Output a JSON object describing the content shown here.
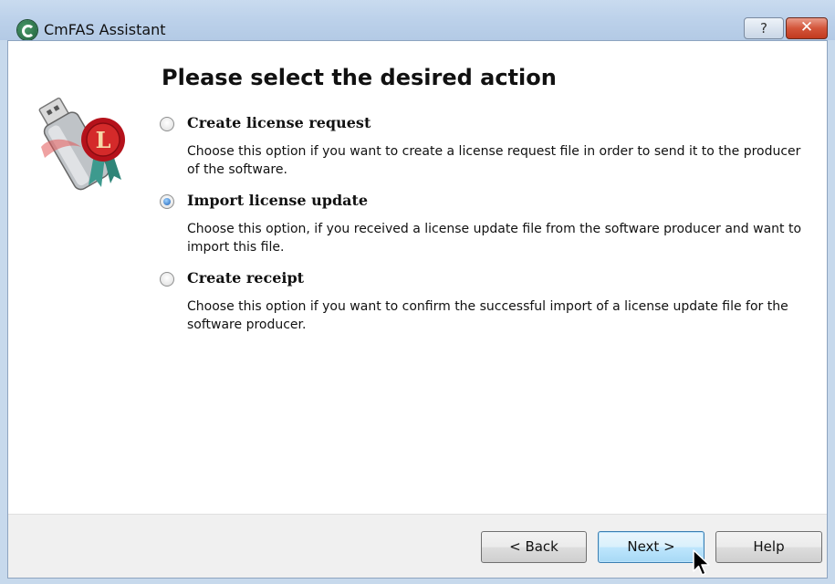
{
  "window": {
    "title": "CmFAS Assistant",
    "help_label": "?",
    "close_label": "✕"
  },
  "page": {
    "heading": "Please select the desired action"
  },
  "options": [
    {
      "label": "Create license request",
      "description": "Choose this option if you want to create a license request file in order to send it to the producer of the software.",
      "selected": false
    },
    {
      "label": "Import license update",
      "description": "Choose this option, if you received a license update file from the software producer and want to import this file.",
      "selected": true
    },
    {
      "label": "Create receipt",
      "description": "Choose this option if you want to confirm the successful import of a license update file for the software producer.",
      "selected": false
    }
  ],
  "buttons": {
    "back": "< Back",
    "next": "Next >",
    "help": "Help"
  },
  "colors": {
    "titlebar": "#bcd1ea",
    "close": "#c23a1e",
    "default_button": "#a7d9f5"
  }
}
